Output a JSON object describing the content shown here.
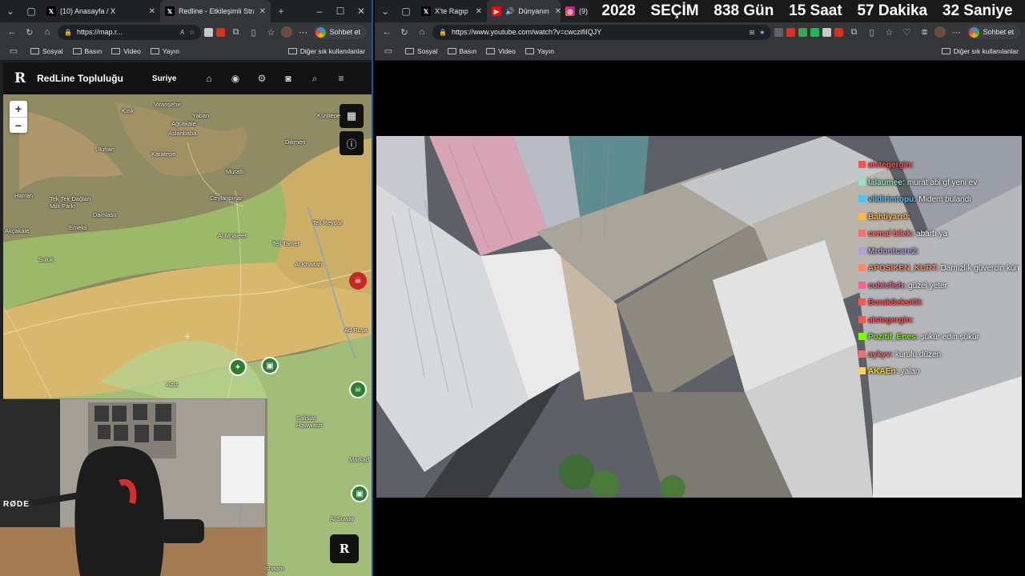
{
  "left_window": {
    "tabs": [
      {
        "label": "(10) Anasayfa / X",
        "icon": "x-logo-icon"
      },
      {
        "label": "Redline - Etkileşimli Strateji",
        "icon": "x-logo-icon",
        "active": true
      }
    ],
    "url": "https://map.r...",
    "bookmarks": [
      "Sosyal",
      "Basın",
      "Video",
      "Yayın"
    ],
    "other_bookmarks": "Diğer sık kullanılanlar",
    "chat_button": "Sohbet et",
    "site": {
      "logo": "R",
      "title": "RedLine Topluluğu",
      "region": "Suriye",
      "badge": "R"
    },
    "map_places": [
      "Viranşehir",
      "Kırık",
      "Yaban",
      "Ağcakale",
      "Aslanbaba",
      "Dikmen",
      "Kızıltepe",
      "Uluhan",
      "Karatepe",
      "Muratlı",
      "Ceylanpınar",
      "Tek Tek Dağları Milli Parkı",
      "Harran",
      "Damlasu",
      "Emekli",
      "Tell Reydar",
      "Akçakale",
      "Al Mnajeer",
      "Tell Tamer",
      "Al Khaitah",
      "Suluk",
      "Ad Ruşa",
      "Salisiat Hawwash",
      "Markad",
      "Al Suwar",
      "Aziz",
      "Ishaam"
    ]
  },
  "right_window": {
    "tabs": [
      {
        "label": "X'te Ragıp Soy",
        "icon": "x-logo-icon"
      },
      {
        "label": "Dünyanın",
        "icon": "youtube-icon",
        "active": true
      },
      {
        "label": "(9)",
        "icon": "instagram-icon"
      }
    ],
    "url": "https://www.youtube.com/watch?v=cwczifiIQJY",
    "bookmarks": [
      "Sosyal",
      "Basın",
      "Video",
      "Yayın"
    ],
    "other_bookmarks": "Diğer sık kullanılanlar",
    "chat_button": "Sohbet et"
  },
  "countdown": {
    "year": "2028",
    "label": "SEÇİM",
    "days": "838 Gün",
    "hours": "15 Saat",
    "minutes": "57 Dakika",
    "seconds": "32 Saniye"
  },
  "webcam": {
    "mic_brand": "RØDE"
  },
  "chat_messages": [
    {
      "user": "aistegergin:",
      "text": "",
      "color": "#ff5252"
    },
    {
      "user": "lalaumee:",
      "text": "murat abi gf yeni ev",
      "color": "#8ee6c4"
    },
    {
      "user": "vildirimtopu:",
      "text": "Midem bulandı",
      "color": "#4fc3f7"
    },
    {
      "user": "Bahtiyarr0:",
      "text": "",
      "color": "#ffb74d"
    },
    {
      "user": "cemal bilek:",
      "text": "abartı ya",
      "color": "#ff6e6e"
    },
    {
      "user": "Mrdontcare2:",
      "text": "",
      "color": "#b39ddb"
    },
    {
      "user": "APOSIKEN_KURT:",
      "text": "Damızlık güvercin kümesi gibi",
      "color": "#ff8a65"
    },
    {
      "user": "cubicfish:",
      "text": "güzel yeter",
      "color": "#f06292"
    },
    {
      "user": "BurakSeksiOl:",
      "text": "",
      "color": "#ff5252"
    },
    {
      "user": "aistegergin:",
      "text": "",
      "color": "#ff5252"
    },
    {
      "user": "Pozitif_Enes:",
      "text": "şükür edin şükür",
      "color": "#7cfc00"
    },
    {
      "user": "aykyv:",
      "text": "kurulu düzen",
      "color": "#e57373"
    },
    {
      "user": "AKAEn:",
      "text": "yalan",
      "color": "#ffd54f"
    }
  ]
}
